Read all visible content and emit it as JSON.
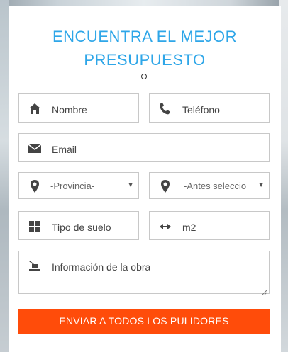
{
  "form": {
    "title_line1": "ENCUENTRA EL MEJOR",
    "title_line2": "PRESUPUESTO",
    "fields": {
      "nombre": "Nombre",
      "telefono": "Teléfono",
      "email": "Email",
      "provincia": "-Provincia-",
      "localidad": "-Antes seleccio",
      "tipo_suelo": "Tipo de suelo",
      "m2": "m2",
      "informacion": "Información de la obra"
    },
    "submit_label": "ENVIAR A TODOS LOS PULIDORES"
  },
  "colors": {
    "accent": "#2ea6e8",
    "button": "#ff4c0a"
  },
  "icons": [
    "home-icon",
    "phone-icon",
    "envelope-icon",
    "map-marker-icon",
    "map-marker-icon",
    "grid-icon",
    "arrows-horizontal-icon",
    "building-icon"
  ]
}
